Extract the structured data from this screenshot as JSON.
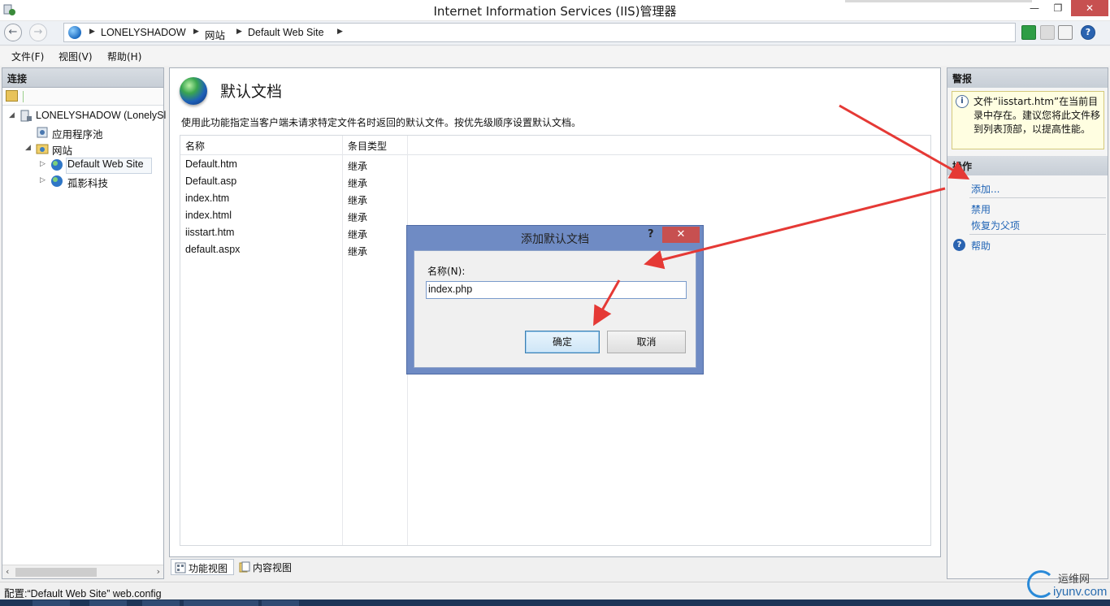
{
  "window": {
    "title": "Internet Information Services (IIS)管理器"
  },
  "address": {
    "crumbs": [
      "LONELYSHADOW",
      "网站",
      "Default Web Site"
    ]
  },
  "menu": [
    "文件(F)",
    "视图(V)",
    "帮助(H)"
  ],
  "connections": {
    "header": "连接",
    "tree": {
      "server": "LONELYSHADOW (LonelySl",
      "app_pools": "应用程序池",
      "sites": "网站",
      "site_default": "Default Web Site",
      "site_other": "孤影科技"
    }
  },
  "main": {
    "title": "默认文档",
    "description": "使用此功能指定当客户端未请求特定文件名时返回的默认文件。按优先级顺序设置默认文档。",
    "columns": [
      "名称",
      "条目类型"
    ],
    "rows": [
      {
        "name": "Default.htm",
        "type": "继承"
      },
      {
        "name": "Default.asp",
        "type": "继承"
      },
      {
        "name": "index.htm",
        "type": "继承"
      },
      {
        "name": "index.html",
        "type": "继承"
      },
      {
        "name": "iisstart.htm",
        "type": "继承"
      },
      {
        "name": "default.aspx",
        "type": "继承"
      }
    ]
  },
  "views": {
    "features": "功能视图",
    "content": "内容视图"
  },
  "actions": {
    "alerts_header": "警报",
    "alert_text": "文件“iisstart.htm”在当前目录中存在。建议您将此文件移到列表顶部，以提高性能。",
    "actions_header": "操作",
    "add": "添加...",
    "disable": "禁用",
    "revert": "恢复为父项",
    "help": "帮助"
  },
  "dialog": {
    "title": "添加默认文档",
    "help_glyph": "?",
    "close_glyph": "✕",
    "name_label": "名称(N):",
    "name_value": "index.php",
    "ok": "确定",
    "cancel": "取消"
  },
  "status": {
    "text": "配置:“Default Web Site” web.config"
  },
  "watermark": {
    "cn": "运维网",
    "en": "iyunv.com"
  }
}
